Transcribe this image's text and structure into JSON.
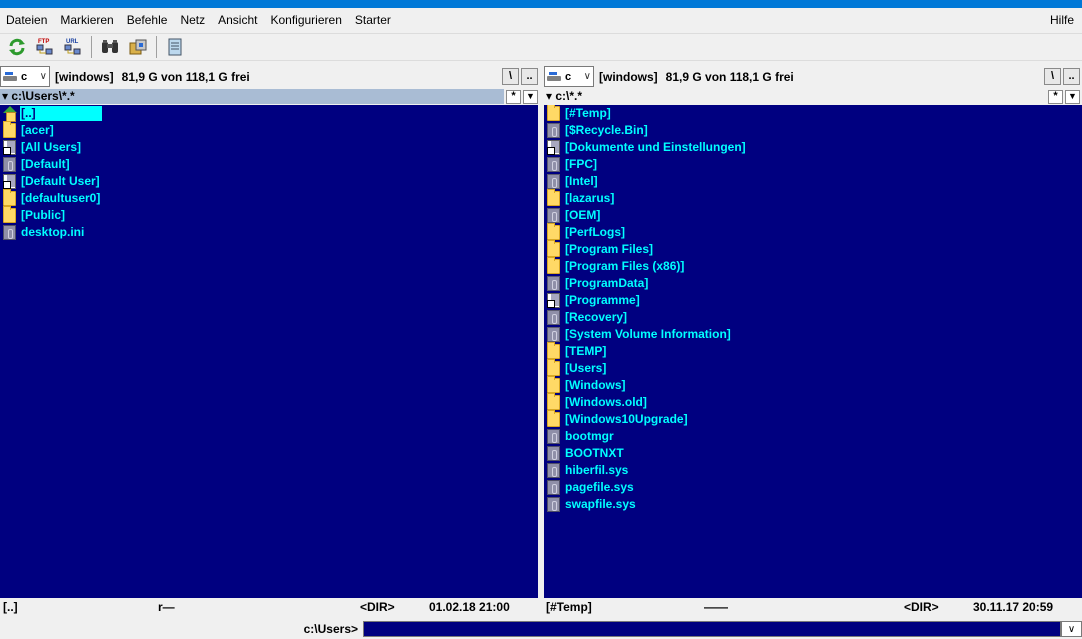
{
  "menu": [
    "Dateien",
    "Markieren",
    "Befehle",
    "Netz",
    "Ansicht",
    "Konfigurieren",
    "Starter"
  ],
  "menu_help": "Hilfe",
  "toolbar": {
    "ftp_label": "FTP",
    "url_label": "URL",
    "icons": [
      "refresh-icon",
      "ftp-icon",
      "url-icon",
      "find-icon",
      "archive-icon",
      "notepad-icon"
    ]
  },
  "left": {
    "drive": "c",
    "volume": "[windows]",
    "free": "81,9 G von 118,1 G frei",
    "root_btn": "\\",
    "up_btn": "..",
    "path": "▾ c:\\Users\\*.*",
    "filter_btn": "*",
    "files": [
      {
        "name": "[..]",
        "icon": "up",
        "selected": true
      },
      {
        "name": "[acer]",
        "icon": "folder"
      },
      {
        "name": "[All Users]",
        "icon": "link"
      },
      {
        "name": "[Default]",
        "icon": "sys"
      },
      {
        "name": "[Default User]",
        "icon": "link"
      },
      {
        "name": "[defaultuser0]",
        "icon": "folder"
      },
      {
        "name": "[Public]",
        "icon": "folder"
      },
      {
        "name": "desktop.ini",
        "icon": "file"
      }
    ],
    "status": {
      "name": "[..]",
      "attr": "r—",
      "size": "<DIR>",
      "date": "01.02.18 21:00"
    }
  },
  "right": {
    "drive": "c",
    "volume": "[windows]",
    "free": "81,9 G von 118,1 G frei",
    "root_btn": "\\",
    "up_btn": "..",
    "path": "▾ c:\\*.*",
    "filter_btn": "*",
    "files": [
      {
        "name": "[#Temp]",
        "icon": "folder"
      },
      {
        "name": "[$Recycle.Bin]",
        "icon": "sys"
      },
      {
        "name": "[Dokumente und Einstellungen]",
        "icon": "link"
      },
      {
        "name": "[FPC]",
        "icon": "sys"
      },
      {
        "name": "[Intel]",
        "icon": "sys"
      },
      {
        "name": "[lazarus]",
        "icon": "folder"
      },
      {
        "name": "[OEM]",
        "icon": "sys"
      },
      {
        "name": "[PerfLogs]",
        "icon": "folder"
      },
      {
        "name": "[Program Files]",
        "icon": "folder"
      },
      {
        "name": "[Program Files (x86)]",
        "icon": "folder"
      },
      {
        "name": "[ProgramData]",
        "icon": "sys"
      },
      {
        "name": "[Programme]",
        "icon": "link"
      },
      {
        "name": "[Recovery]",
        "icon": "sys"
      },
      {
        "name": "[System Volume Information]",
        "icon": "sys"
      },
      {
        "name": "[TEMP]",
        "icon": "folder"
      },
      {
        "name": "[Users]",
        "icon": "folder"
      },
      {
        "name": "[Windows]",
        "icon": "folder"
      },
      {
        "name": "[Windows.old]",
        "icon": "folder"
      },
      {
        "name": "[Windows10Upgrade]",
        "icon": "folder"
      },
      {
        "name": "bootmgr",
        "icon": "file"
      },
      {
        "name": "BOOTNXT",
        "icon": "file"
      },
      {
        "name": "hiberfil.sys",
        "icon": "file"
      },
      {
        "name": "pagefile.sys",
        "icon": "file"
      },
      {
        "name": "swapfile.sys",
        "icon": "file"
      }
    ],
    "status": {
      "name": "[#Temp]",
      "attr": "——",
      "size": "<DIR>",
      "date": "30.11.17 20:59"
    }
  },
  "cmdline": {
    "prompt": "c:\\Users>",
    "value": ""
  },
  "colors": {
    "panel_bg": "#000080",
    "file_text": "#00ffff",
    "titlebar": "#0078d7",
    "active_path": "#a9bcd4"
  }
}
